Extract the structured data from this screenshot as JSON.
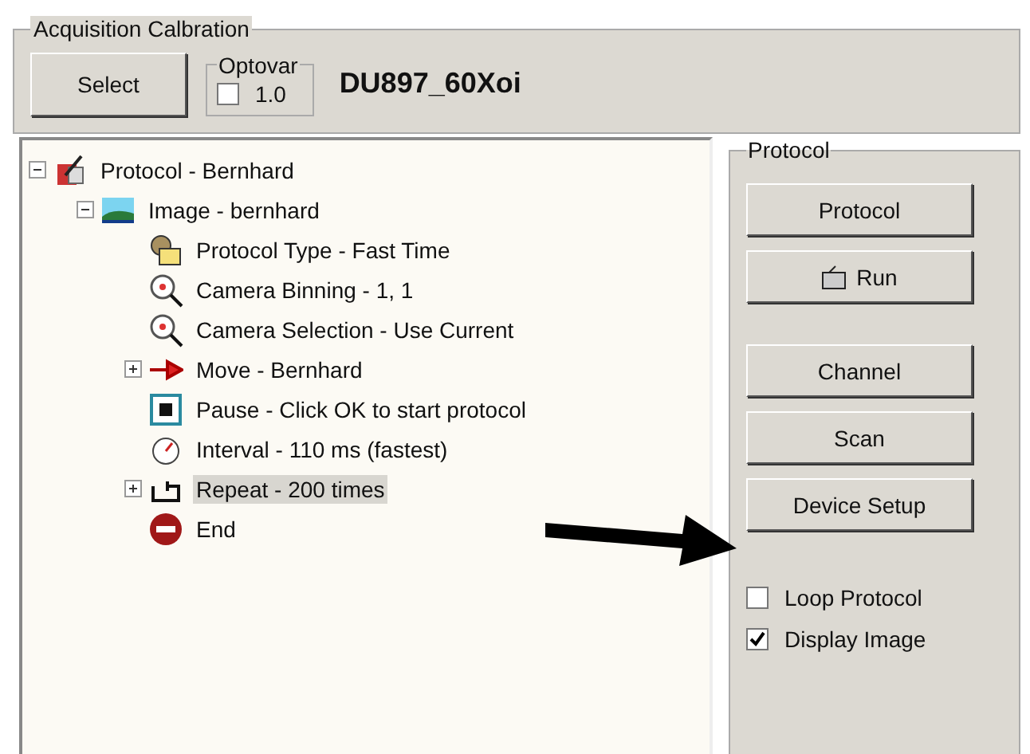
{
  "calibration": {
    "title": "Acquisition Calbration",
    "select_button": "Select",
    "optovar": {
      "title": "Optovar",
      "checked": false,
      "value": "1.0"
    },
    "objective": "DU897_60Xoi"
  },
  "tree": [
    {
      "label": "Protocol - Bernhard",
      "kind": "protocol",
      "expanded": true,
      "selected": false,
      "children": [
        {
          "label": "Image - bernhard",
          "kind": "image",
          "expanded": true,
          "selected": false,
          "children": [
            {
              "label": "Protocol Type - Fast Time",
              "kind": "type",
              "selected": false
            },
            {
              "label": "Camera Binning - 1, 1",
              "kind": "camera",
              "selected": false
            },
            {
              "label": "Camera Selection - Use Current",
              "kind": "camera",
              "selected": false
            },
            {
              "label": "Move - Bernhard",
              "kind": "move",
              "expanded": false,
              "selected": false
            },
            {
              "label": "Pause - Click OK to start protocol",
              "kind": "pause",
              "selected": false
            },
            {
              "label": "Interval - 110 ms (fastest)",
              "kind": "interval",
              "selected": false
            },
            {
              "label": "Repeat - 200 times",
              "kind": "repeat",
              "expanded": false,
              "selected": true
            },
            {
              "label": "End",
              "kind": "end",
              "selected": false
            }
          ]
        }
      ]
    }
  ],
  "protocol_panel": {
    "title": "Protocol",
    "buttons": [
      {
        "label": "Protocol",
        "kind": "plain"
      },
      {
        "label": "Run",
        "kind": "run"
      },
      {
        "label": "Channel",
        "kind": "plain"
      },
      {
        "label": "Scan",
        "kind": "plain"
      },
      {
        "label": "Device Setup",
        "kind": "plain"
      }
    ],
    "options": [
      {
        "label": "Loop Protocol",
        "checked": false
      },
      {
        "label": "Display Image",
        "checked": true
      }
    ]
  }
}
